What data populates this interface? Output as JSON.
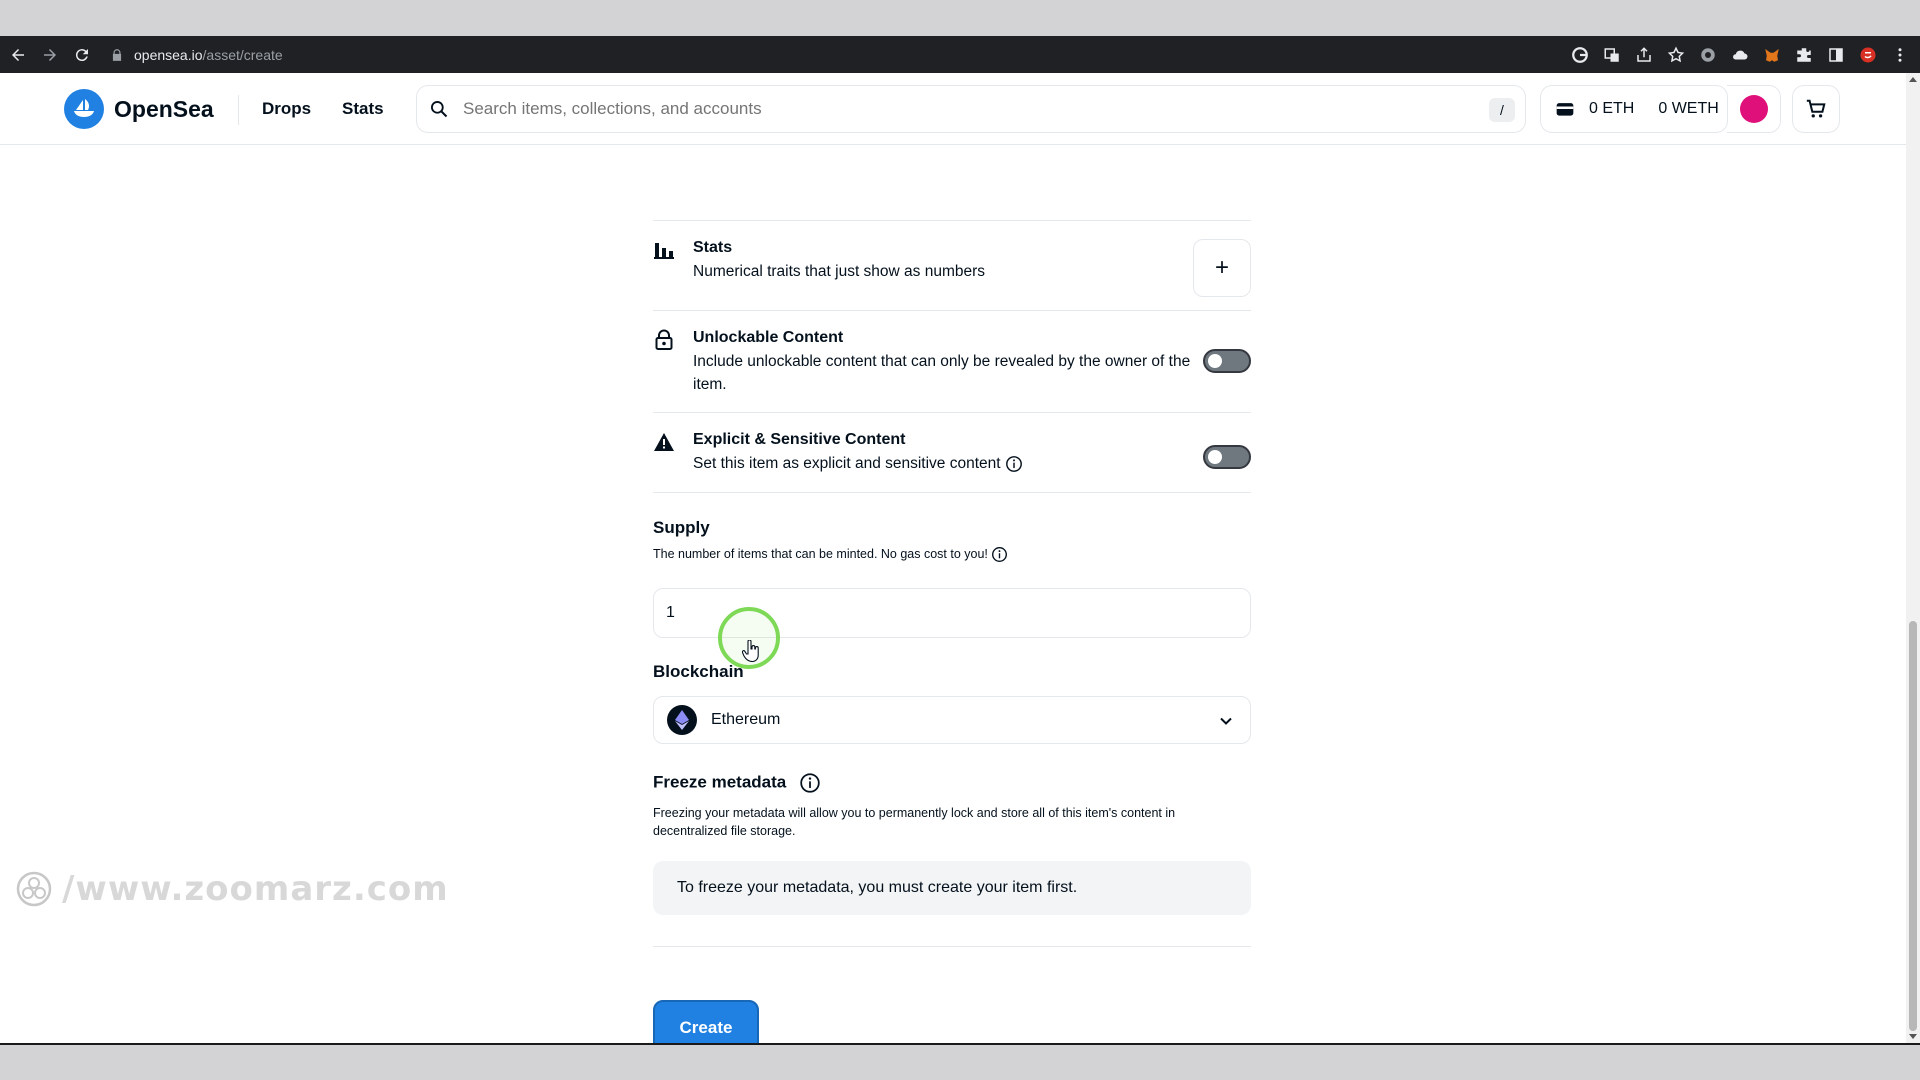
{
  "browser": {
    "url_host": "opensea.io",
    "url_path": "/asset/create"
  },
  "header": {
    "brand": "OpenSea",
    "nav": [
      "Drops",
      "Stats"
    ],
    "search_placeholder": "Search items, collections, and accounts",
    "search_shortcut": "/",
    "eth_balance": "0 ETH",
    "weth_balance": "0 WETH"
  },
  "traits": {
    "stats_title": "Stats",
    "stats_desc": "Numerical traits that just show as numbers",
    "stats_add": "+",
    "unlockable_title": "Unlockable Content",
    "unlockable_desc": "Include unlockable content that can only be revealed by the owner of the item.",
    "explicit_title": "Explicit & Sensitive Content",
    "explicit_desc": "Set this item as explicit and sensitive content"
  },
  "supply": {
    "title": "Supply",
    "desc": "The number of items that can be minted. No gas cost to you!",
    "value": "1"
  },
  "blockchain": {
    "title": "Blockchain",
    "selected": "Ethereum"
  },
  "freeze": {
    "title": "Freeze metadata",
    "desc": "Freezing your metadata will allow you to permanently lock and store all of this item's content in decentralized file storage.",
    "note": "To freeze your metadata, you must create your item first."
  },
  "actions": {
    "create_label": "Create"
  },
  "watermark": {
    "text": "/www.zoomarz.com"
  },
  "colors": {
    "accent": "#2081e2",
    "avatar": "#e0107a",
    "click_ring": "#7ed957"
  }
}
